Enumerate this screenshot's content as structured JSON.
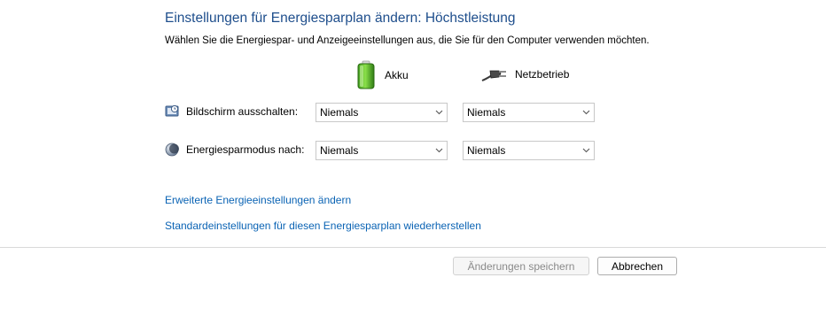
{
  "header": {
    "title": "Einstellungen für Energiesparplan ändern: Höchstleistung",
    "subtitle": "Wählen Sie die Energiespar- und Anzeigeeinstellungen aus, die Sie für den Computer verwenden möchten."
  },
  "columns": {
    "battery_label": "Akku",
    "plugged_label": "Netzbetrieb",
    "battery_icon": "battery-icon",
    "plugged_icon": "power-plug-icon"
  },
  "settings": {
    "display": {
      "label": "Bildschirm ausschalten:",
      "icon": "display-timer-icon",
      "battery_value": "Niemals",
      "plugged_value": "Niemals"
    },
    "sleep": {
      "label": "Energiesparmodus nach:",
      "icon": "sleep-moon-icon",
      "battery_value": "Niemals",
      "plugged_value": "Niemals"
    }
  },
  "links": {
    "advanced": "Erweiterte Energieeinstellungen ändern",
    "restore": "Standardeinstellungen für diesen Energiesparplan wiederherstellen"
  },
  "buttons": {
    "save": "Änderungen speichern",
    "cancel": "Abbrechen"
  },
  "colors": {
    "title": "#1e4e8c",
    "link": "#0a63b4"
  }
}
